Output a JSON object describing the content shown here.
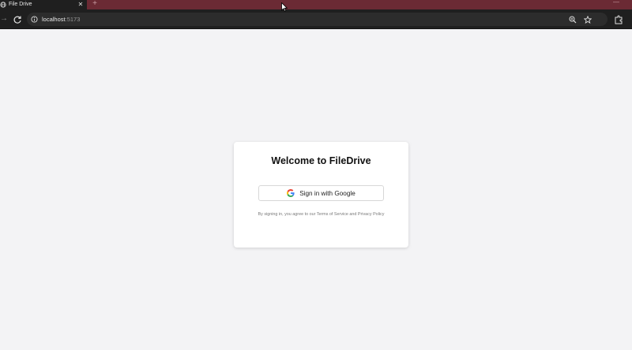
{
  "browser": {
    "tab_title": "File Drive",
    "tab_close": "✕",
    "new_tab": "+",
    "window_minimize": "—",
    "url_host": "localhost",
    "url_port": ":5173",
    "accent_color": "#6b2a34"
  },
  "login": {
    "heading": "Welcome to FileDrive",
    "google_button_label": "Sign in with Google",
    "terms_text": "By signing in, you agree to our Terms of Service and Privacy Policy"
  }
}
